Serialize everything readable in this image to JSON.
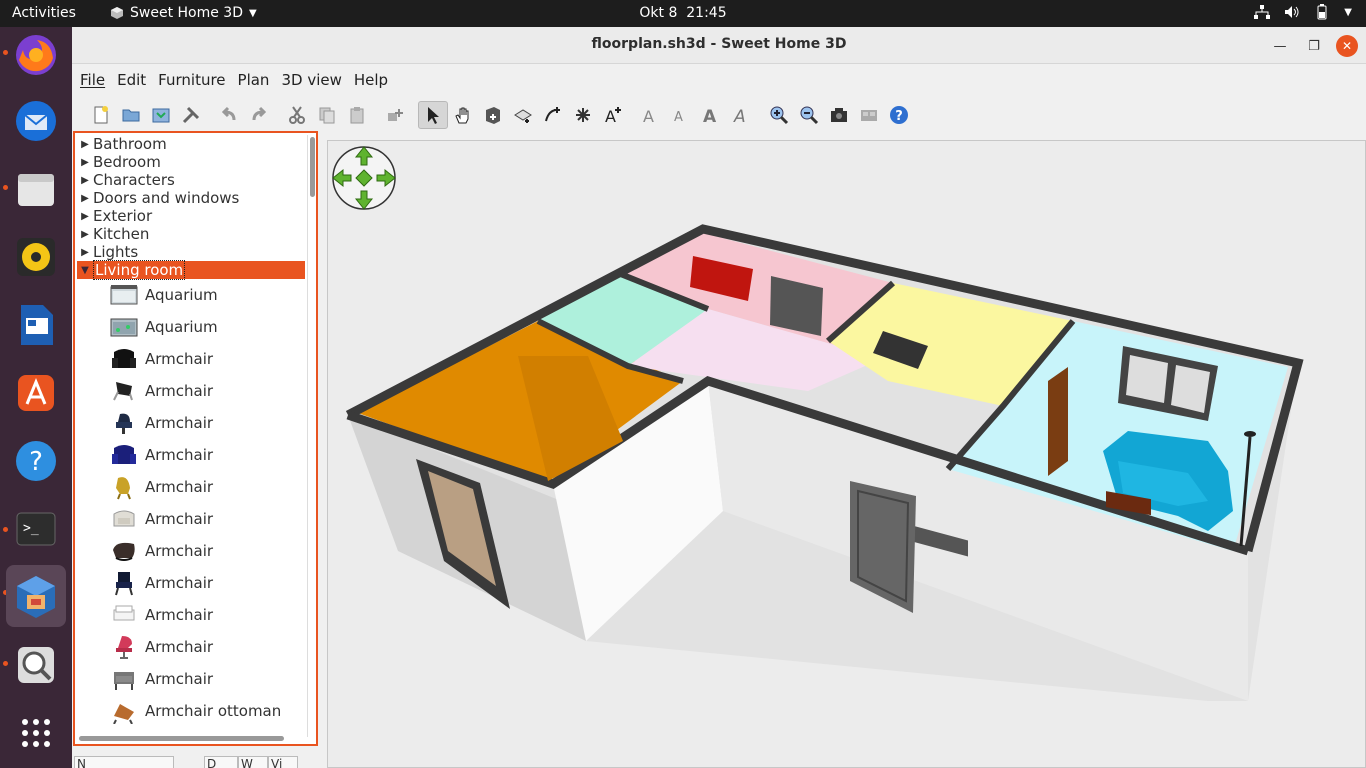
{
  "topbar": {
    "activities": "Activities",
    "app_name": "Sweet Home 3D",
    "date": "Okt 8",
    "time": "21:45"
  },
  "window": {
    "title": "floorplan.sh3d - Sweet Home 3D"
  },
  "menu": {
    "file": "File",
    "edit": "Edit",
    "furniture": "Furniture",
    "plan": "Plan",
    "view3d": "3D view",
    "help": "Help"
  },
  "catalog": {
    "categories": [
      {
        "label": "Bathroom"
      },
      {
        "label": "Bedroom"
      },
      {
        "label": "Characters"
      },
      {
        "label": "Doors and windows"
      },
      {
        "label": "Exterior"
      },
      {
        "label": "Kitchen"
      },
      {
        "label": "Lights"
      },
      {
        "label": "Living room"
      }
    ],
    "items": [
      {
        "label": "Aquarium",
        "icon": "aquarium-icon"
      },
      {
        "label": "Aquarium",
        "icon": "aquarium-icon"
      },
      {
        "label": "Armchair",
        "icon": "armchair-icon"
      },
      {
        "label": "Armchair",
        "icon": "armchair-icon"
      },
      {
        "label": "Armchair",
        "icon": "armchair-icon"
      },
      {
        "label": "Armchair",
        "icon": "armchair-icon"
      },
      {
        "label": "Armchair",
        "icon": "armchair-icon"
      },
      {
        "label": "Armchair",
        "icon": "armchair-icon"
      },
      {
        "label": "Armchair",
        "icon": "armchair-icon"
      },
      {
        "label": "Armchair",
        "icon": "armchair-icon"
      },
      {
        "label": "Armchair",
        "icon": "armchair-icon"
      },
      {
        "label": "Armchair",
        "icon": "armchair-icon"
      },
      {
        "label": "Armchair",
        "icon": "armchair-icon"
      },
      {
        "label": "Armchair ottoman",
        "icon": "ottoman-icon"
      }
    ]
  },
  "table_headers": [
    "N",
    "D",
    "W",
    "Vi"
  ],
  "colors": {
    "accent": "#e95420",
    "dock_bg": "#3a2737",
    "topbar_bg": "#1d1d1d"
  }
}
